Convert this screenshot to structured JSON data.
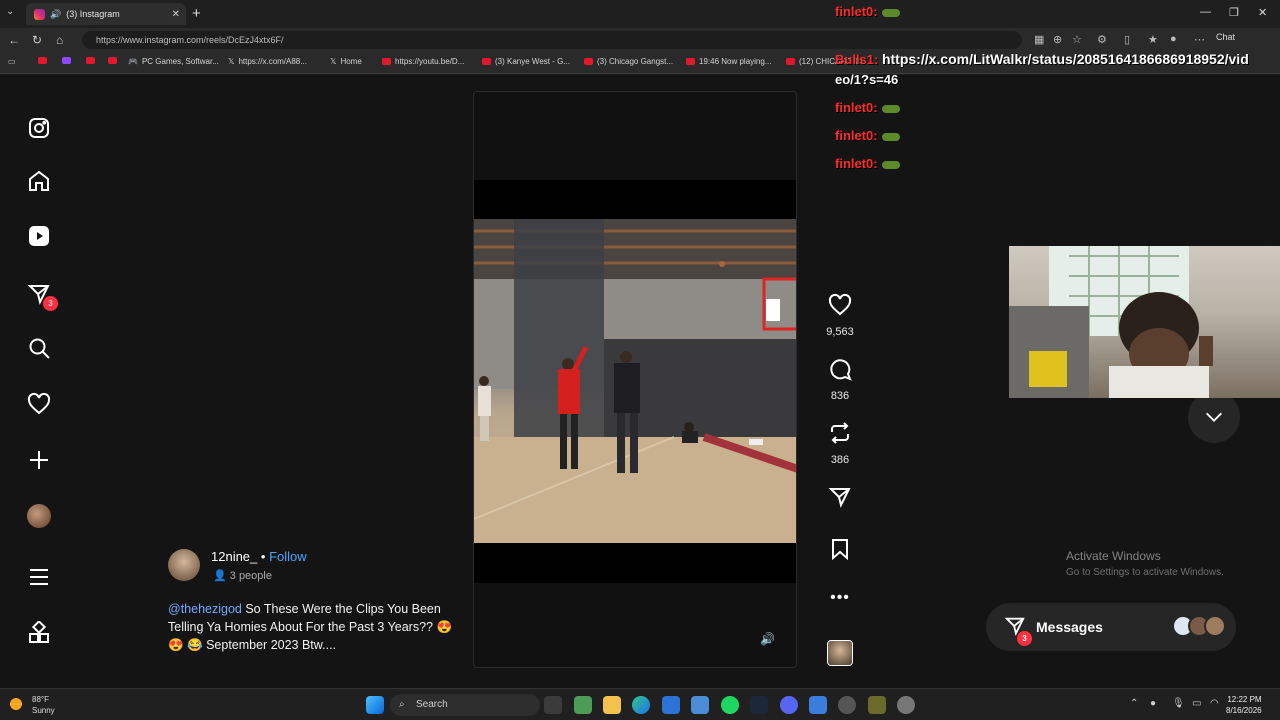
{
  "browser": {
    "tab_title": "(3) Instagram",
    "url": "https://www.instagram.com/reels/DcEzJ4xtx6F/",
    "chat_label": "Chat",
    "bookmarks": [
      "PC Games, Softwar...",
      "https://x.com/A88...",
      "Home",
      "https://youtu.be/D...",
      "(3) Kanye West - G...",
      "(3) Chicago Gangst...",
      "19:46 Now playing...",
      "(12) CHICAGO CL..."
    ]
  },
  "sidebar": {
    "items": [
      "instagram-logo",
      "home",
      "reels",
      "messages",
      "search",
      "notifications",
      "create",
      "profile",
      "more",
      "also-from-meta"
    ],
    "messages_badge": "3"
  },
  "reel": {
    "author": "12nine_",
    "separator": "•",
    "follow_label": "Follow",
    "people": "3 people",
    "caption_mention": "@thehezigod",
    "caption_text": " So These Were the Clips You Been Telling Ya Homies About For the Past 3 Years?? 😍 😍 😂 September 2023 Btw....",
    "likes": "9,563",
    "comments": "836",
    "reposts": "386"
  },
  "messages": {
    "label": "Messages",
    "badge": "3"
  },
  "overlay": {
    "chat_lines": [
      {
        "user": "finlet0:",
        "text": ""
      },
      {
        "user": "Bulls1:",
        "text": "https://x.com/LitWalkr/status/2085164186686918952/vid"
      },
      {
        "user": "",
        "text": "eo/1?s=46"
      },
      {
        "user": "finlet0:",
        "text": ""
      },
      {
        "user": "finlet0:",
        "text": ""
      },
      {
        "user": "finlet0:",
        "text": ""
      }
    ]
  },
  "watermark": {
    "line1": "Activate Windows",
    "line2": "Go to Settings to activate Windows."
  },
  "taskbar": {
    "weather_temp": "88°F",
    "weather_desc": "Sunny",
    "search_placeholder": "Search",
    "time": "12:22 PM",
    "date": "8/16/2026"
  }
}
